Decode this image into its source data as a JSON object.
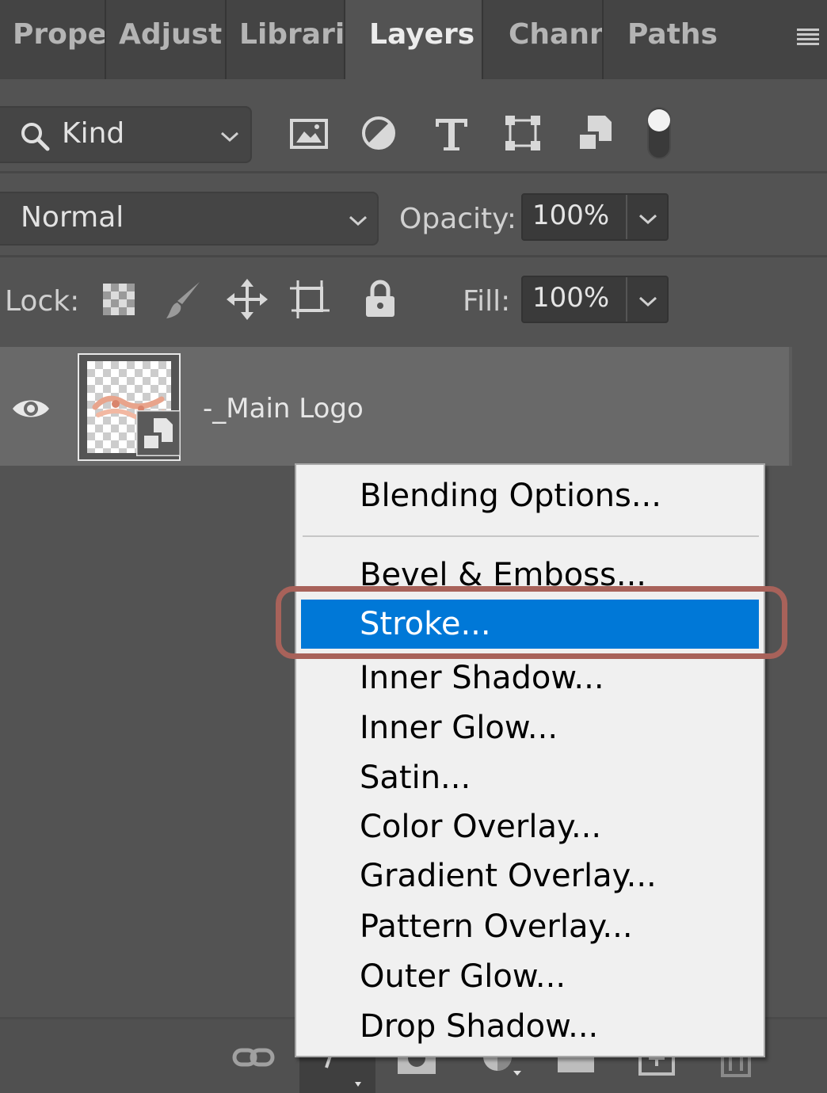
{
  "tabs": [
    {
      "label": "Proper",
      "active": false
    },
    {
      "label": "Adjust",
      "active": false
    },
    {
      "label": "Librari",
      "active": false
    },
    {
      "label": "Layers",
      "active": true
    },
    {
      "label": "Chann",
      "active": false
    },
    {
      "label": "Paths",
      "active": false
    }
  ],
  "filter": {
    "kind_label": "Kind",
    "icons": [
      "pixel-layer-filter-icon",
      "adjustment-layer-filter-icon",
      "type-layer-filter-icon",
      "shape-layer-filter-icon",
      "smart-object-filter-icon",
      "filter-toggle-icon"
    ]
  },
  "blend": {
    "mode": "Normal",
    "opacity_label": "Opacity:",
    "opacity_value": "100%"
  },
  "lock": {
    "label": "Lock:",
    "icons": [
      "lock-transparent-pixels-icon",
      "lock-image-pixels-icon",
      "lock-position-icon",
      "lock-artboard-icon",
      "lock-all-icon"
    ],
    "fill_label": "Fill:",
    "fill_value": "100%"
  },
  "layer": {
    "name": "-_Main Logo",
    "visible": true
  },
  "context_menu": {
    "items": [
      {
        "label": "Blending Options...",
        "selected": false
      },
      {
        "label": "Bevel & Emboss...",
        "selected": false
      },
      {
        "label": "Stroke...",
        "selected": true
      },
      {
        "label": "Inner Shadow...",
        "selected": false
      },
      {
        "label": "Inner Glow...",
        "selected": false
      },
      {
        "label": "Satin...",
        "selected": false
      },
      {
        "label": "Color Overlay...",
        "selected": false
      },
      {
        "label": "Gradient Overlay...",
        "selected": false
      },
      {
        "label": "Pattern Overlay...",
        "selected": false
      },
      {
        "label": "Outer Glow...",
        "selected": false
      },
      {
        "label": "Drop Shadow...",
        "selected": false
      }
    ]
  },
  "colors": {
    "panel_bg": "#535353",
    "menu_bg": "#f0f0f0",
    "selection": "#0078d7",
    "highlight_ring": "#a8625a"
  }
}
